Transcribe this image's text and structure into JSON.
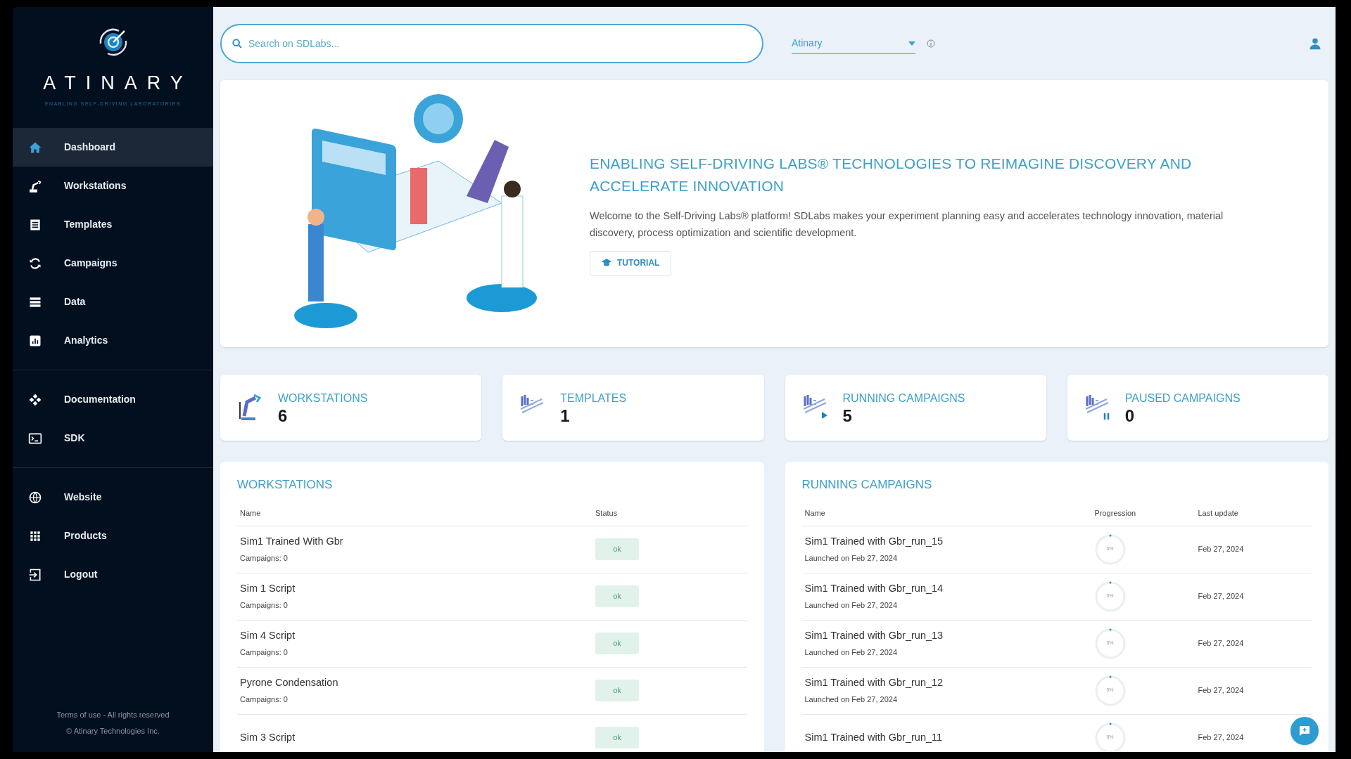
{
  "sidebar": {
    "brand": "ATINARY",
    "tagline": "ENABLING SELF-DRIVING LABORATORIES",
    "groups": [
      [
        {
          "label": "Dashboard",
          "selected": true
        },
        {
          "label": "Workstations",
          "selected": false
        },
        {
          "label": "Templates",
          "selected": false
        },
        {
          "label": "Campaigns",
          "selected": false
        },
        {
          "label": "Data",
          "selected": false
        },
        {
          "label": "Analytics",
          "selected": false
        }
      ],
      [
        {
          "label": "Documentation",
          "selected": false
        },
        {
          "label": "SDK",
          "selected": false
        }
      ],
      [
        {
          "label": "Website",
          "selected": false
        },
        {
          "label": "Products",
          "selected": false
        },
        {
          "label": "Logout",
          "selected": false
        }
      ]
    ],
    "footer": [
      "Terms of use - All rights reserved",
      "© Atinary Technologies Inc."
    ]
  },
  "header": {
    "search": {
      "placeholder": "Search on SDLabs..."
    },
    "organization": "Atinary"
  },
  "hero": {
    "title": "ENABLING SELF-DRIVING LABS® TECHNOLOGIES TO REIMAGINE DISCOVERY AND ACCELERATE INNOVATION",
    "text": "Welcome to the Self-Driving Labs® platform! SDLabs makes your experiment planning easy and accelerates technology innovation, material discovery, process optimization and scientific development.",
    "button": "TUTORIAL"
  },
  "stats": [
    {
      "label": "WORKSTATIONS",
      "value": "6",
      "kind": "robot"
    },
    {
      "label": "TEMPLATES",
      "value": "1",
      "kind": "template"
    },
    {
      "label": "RUNNING CAMPAIGNS",
      "value": "5",
      "kind": "running"
    },
    {
      "label": "PAUSED CAMPAIGNS",
      "value": "0",
      "kind": "paused"
    }
  ],
  "workstations": {
    "title": "WORKSTATIONS",
    "columns": [
      "Name",
      "Status"
    ],
    "rows": [
      {
        "name": "Sim1 Trained With Gbr",
        "sub": "Campaigns: 0",
        "status": "ok"
      },
      {
        "name": "Sim 1 Script",
        "sub": "Campaigns: 0",
        "status": "ok"
      },
      {
        "name": "Sim 4 Script",
        "sub": "Campaigns: 0",
        "status": "ok"
      },
      {
        "name": "Pyrone Condensation",
        "sub": "Campaigns: 0",
        "status": "ok"
      },
      {
        "name": "Sim 3 Script",
        "status": "ok"
      }
    ]
  },
  "running_campaigns": {
    "title": "RUNNING CAMPAIGNS",
    "columns": [
      "Name",
      "Progression",
      "Last update"
    ],
    "rows": [
      {
        "name": "Sim1 Trained with Gbr_run_15",
        "sub": "Launched on Feb 27, 2024",
        "progress": "0%",
        "level": 0,
        "updated": "Feb 27, 2024"
      },
      {
        "name": "Sim1 Trained with Gbr_run_14",
        "sub": "Launched on Feb 27, 2024",
        "progress": "0%",
        "level": 0,
        "updated": "Feb 27, 2024"
      },
      {
        "name": "Sim1 Trained with Gbr_run_13",
        "sub": "Launched on Feb 27, 2024",
        "progress": "0%",
        "level": 0,
        "updated": "Feb 27, 2024"
      },
      {
        "name": "Sim1 Trained with Gbr_run_12",
        "sub": "Launched on Feb 27, 2024",
        "progress": "0%",
        "level": 0,
        "updated": "Feb 27, 2024"
      },
      {
        "name": "Sim1 Trained with Gbr_run_11",
        "progress": "0%",
        "level": 0,
        "updated": "Feb 27, 2024"
      }
    ]
  }
}
